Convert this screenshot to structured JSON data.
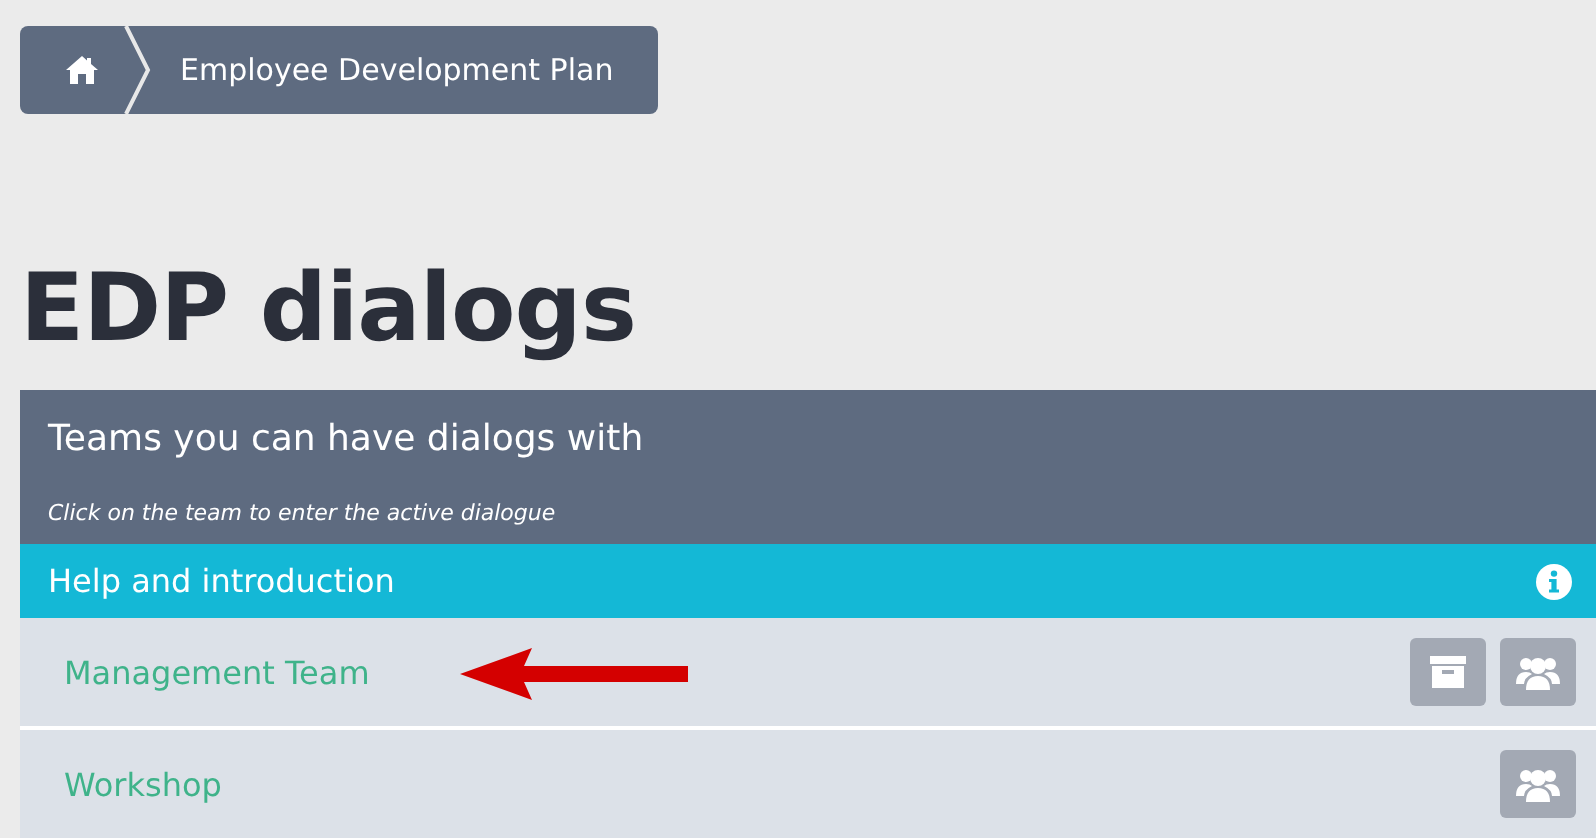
{
  "breadcrumb": {
    "items": [
      {
        "kind": "home"
      },
      {
        "kind": "text",
        "label": "Employee Development Plan"
      }
    ]
  },
  "page_title": "EDP dialogs",
  "panel": {
    "title": "Teams you can have dialogs with",
    "subtitle": "Click on the team to enter the active dialogue",
    "help_bar": {
      "label": "Help and introduction"
    },
    "rows": [
      {
        "name": "Management Team",
        "pointed_by_arrow": true,
        "actions": [
          {
            "kind": "archive"
          },
          {
            "kind": "team"
          }
        ]
      },
      {
        "name": "Workshop",
        "pointed_by_arrow": false,
        "actions": [
          {
            "kind": "team"
          }
        ]
      }
    ]
  }
}
